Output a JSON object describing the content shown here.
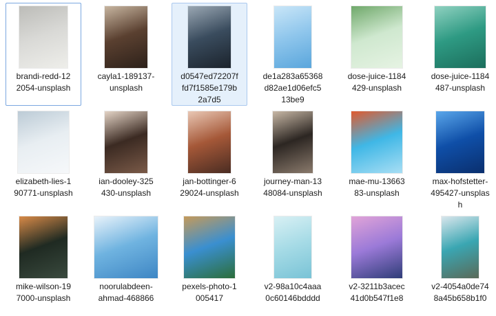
{
  "files": [
    {
      "name": "brandi-redd-122054-unsplash",
      "lines": [
        "brandi-redd-12",
        "2054-unsplash"
      ],
      "state": "focused",
      "colors": [
        "#d9d9d6",
        "#bcbcb8",
        "#eeeeea"
      ]
    },
    {
      "name": "cayla1-189137-unsplash",
      "lines": [
        "cayla1-189137-",
        "unsplash"
      ],
      "state": "",
      "colors": [
        "#5a4030",
        "#c7b5a0",
        "#2d211a"
      ]
    },
    {
      "name": "d0547ed72207ffd7f1585e179b2a7d5",
      "lines": [
        "d0547ed72207f",
        "fd7f1585e179b",
        "2a7d5"
      ],
      "state": "selected",
      "colors": [
        "#3a4c5e",
        "#9aa7b3",
        "#1b232c"
      ]
    },
    {
      "name": "de1a283a65368d82ae1d06efc513be9",
      "lines": [
        "de1a283a65368",
        "d82ae1d06efc5",
        "13be9"
      ],
      "state": "",
      "colors": [
        "#8fc6ec",
        "#c9e6f8",
        "#5aa6dc"
      ]
    },
    {
      "name": "dose-juice-1184429-unsplash",
      "lines": [
        "dose-juice-1184",
        "429-unsplash"
      ],
      "state": "",
      "colors": [
        "#cfe8cf",
        "#6fa86a",
        "#e6f3e3"
      ]
    },
    {
      "name": "dose-juice-1184487-unsplash",
      "lines": [
        "dose-juice-1184",
        "487-unsplash"
      ],
      "state": "",
      "colors": [
        "#2e9a83",
        "#8fd1c0",
        "#1c6e5c"
      ]
    },
    {
      "name": "elizabeth-lies-190771-unsplash",
      "lines": [
        "elizabeth-lies-1",
        "90771-unsplash"
      ],
      "state": "",
      "colors": [
        "#e8eef2",
        "#bccbd6",
        "#f6f8fa"
      ]
    },
    {
      "name": "ian-dooley-325430-unsplash",
      "lines": [
        "ian-dooley-325",
        "430-unsplash"
      ],
      "state": "",
      "colors": [
        "#3b2a22",
        "#e4d4c6",
        "#7a5a48"
      ]
    },
    {
      "name": "jan-bottinger-629024-unsplash",
      "lines": [
        "jan-bottinger-6",
        "29024-unsplash"
      ],
      "state": "",
      "colors": [
        "#a55838",
        "#e9c7b4",
        "#4a2c22"
      ]
    },
    {
      "name": "journey-man-1348084-unsplash",
      "lines": [
        "journey-man-13",
        "48084-unsplash"
      ],
      "state": "",
      "colors": [
        "#2c2622",
        "#c8b8a6",
        "#8a7a6c"
      ]
    },
    {
      "name": "mae-mu-1366383-unsplash",
      "lines": [
        "mae-mu-13663",
        "83-unsplash"
      ],
      "state": "",
      "colors": [
        "#3fb7e6",
        "#e05a2e",
        "#a8def4"
      ]
    },
    {
      "name": "max-hofstetter-495427-unsplash",
      "lines": [
        "max-hofstetter-",
        "495427-unsplas",
        "h"
      ],
      "state": "",
      "colors": [
        "#0f4fa8",
        "#5aa6ea",
        "#0a2f6e"
      ]
    },
    {
      "name": "mike-wilson-197000-unsplash",
      "lines": [
        "mike-wilson-19",
        "7000-unsplash"
      ],
      "state": "",
      "colors": [
        "#1f2a22",
        "#d88a48",
        "#3a4a3e"
      ]
    },
    {
      "name": "noorulabdeen-ahmad-468866",
      "lines": [
        "noorulabdeen-",
        "ahmad-468866"
      ],
      "state": "",
      "colors": [
        "#6fb3e0",
        "#e8f2fa",
        "#3e86c4"
      ]
    },
    {
      "name": "pexels-photo-1005417",
      "lines": [
        "pexels-photo-1",
        "005417"
      ],
      "state": "",
      "colors": [
        "#3a8fd0",
        "#c59a5a",
        "#2c6e3a"
      ]
    },
    {
      "name": "v2-98a10c4aaa0c60146bdddd",
      "lines": [
        "v2-98a10c4aaa",
        "0c60146bdddd"
      ],
      "state": "",
      "colors": [
        "#a6dbe6",
        "#d8f0f4",
        "#79c3d6"
      ]
    },
    {
      "name": "v2-3211b3acec41d0b547f1e8",
      "lines": [
        "v2-3211b3acec",
        "41d0b547f1e8"
      ],
      "state": "",
      "colors": [
        "#9b7ad8",
        "#e1a4d8",
        "#2f3d78"
      ]
    },
    {
      "name": "v2-4054a0de748a45b658b1f0",
      "lines": [
        "v2-4054a0de74",
        "8a45b658b1f0"
      ],
      "state": "",
      "colors": [
        "#3aa6b2",
        "#d9e6ec",
        "#5a6a58"
      ]
    }
  ]
}
